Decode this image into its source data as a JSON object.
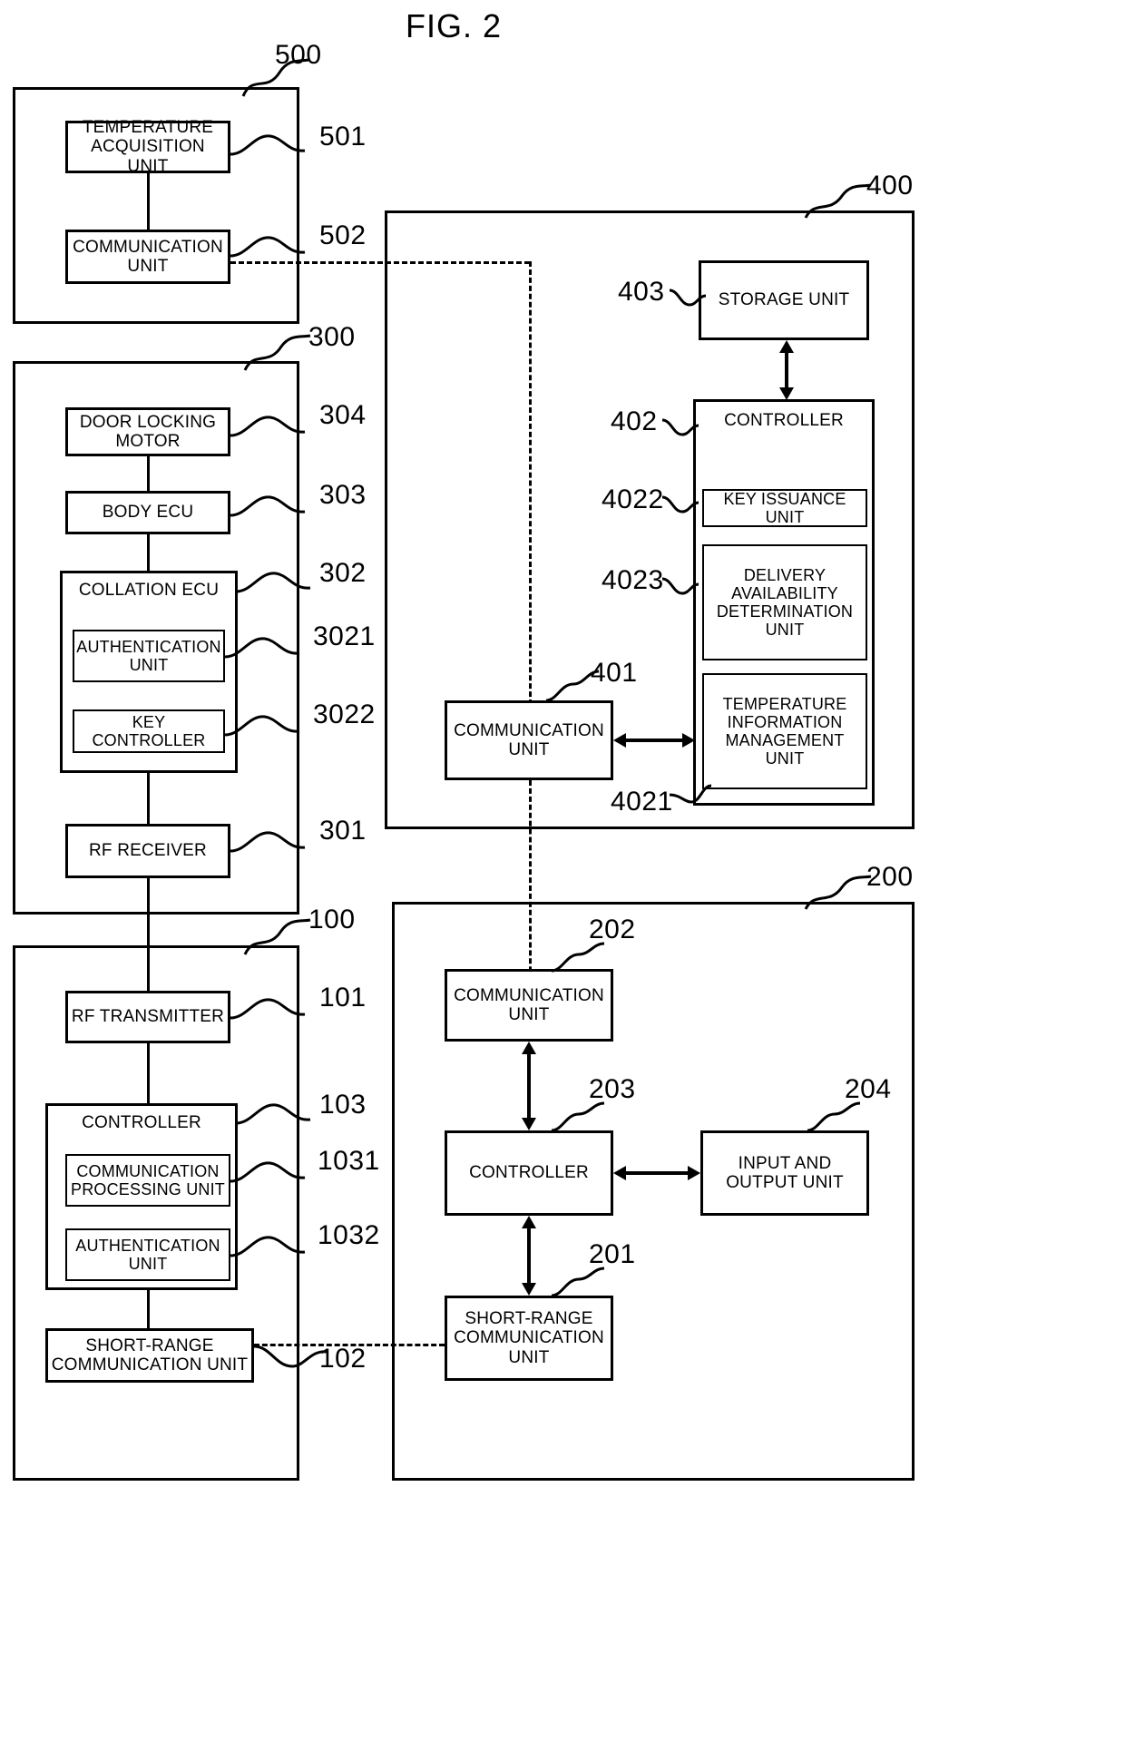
{
  "figure": {
    "title": "FIG. 2"
  },
  "groups": {
    "g500": {
      "ref": "500"
    },
    "g300": {
      "ref": "300"
    },
    "g100": {
      "ref": "100"
    },
    "g400": {
      "ref": "400"
    },
    "g200": {
      "ref": "200"
    }
  },
  "blocks": {
    "temperature_acquisition_unit": {
      "label": "TEMPERATURE ACQUISITION UNIT",
      "ref": "501"
    },
    "sensor_communication_unit": {
      "label": "COMMUNICATION UNIT",
      "ref": "502"
    },
    "door_locking_motor": {
      "label": "DOOR LOCKING MOTOR",
      "ref": "304"
    },
    "body_ecu": {
      "label": "BODY ECU",
      "ref": "303"
    },
    "collation_ecu": {
      "label": "COLLATION ECU",
      "ref": "302"
    },
    "authentication_unit_302": {
      "label": "AUTHENTICATION UNIT",
      "ref": "3021"
    },
    "key_controller": {
      "label": "KEY CONTROLLER",
      "ref": "3022"
    },
    "rf_receiver": {
      "label": "RF RECEIVER",
      "ref": "301"
    },
    "rf_transmitter": {
      "label": "RF TRANSMITTER",
      "ref": "101"
    },
    "controller_100": {
      "label": "CONTROLLER",
      "ref": "103"
    },
    "communication_processing_unit": {
      "label": "COMMUNICATION PROCESSING UNIT",
      "ref": "1031"
    },
    "authentication_unit_103": {
      "label": "AUTHENTICATION UNIT",
      "ref": "1032"
    },
    "short_range_communication_unit_100": {
      "label": "SHORT-RANGE COMMUNICATION UNIT",
      "ref": "102"
    },
    "storage_unit": {
      "label": "STORAGE UNIT",
      "ref": "403"
    },
    "controller_400": {
      "label": "CONTROLLER",
      "ref": "402"
    },
    "key_issuance_unit": {
      "label": "KEY ISSUANCE UNIT",
      "ref": "4022"
    },
    "delivery_availability_determination_unit": {
      "label": "DELIVERY AVAILABILITY DETERMINATION UNIT",
      "ref": "4023"
    },
    "temperature_information_management_unit": {
      "label": "TEMPERATURE INFORMATION MANAGEMENT UNIT",
      "ref": "4021"
    },
    "communication_unit_400": {
      "label": "COMMUNICATION UNIT",
      "ref": "401"
    },
    "communication_unit_200": {
      "label": "COMMUNICATION UNIT",
      "ref": "202"
    },
    "controller_200": {
      "label": "CONTROLLER",
      "ref": "203"
    },
    "input_and_output_unit": {
      "label": "INPUT AND OUTPUT UNIT",
      "ref": "204"
    },
    "short_range_communication_unit_200": {
      "label": "SHORT-RANGE COMMUNICATION UNIT",
      "ref": "201"
    }
  },
  "chart_data": {
    "type": "diagram",
    "title": "FIG. 2",
    "nodes": [
      {
        "id": "500",
        "label": "",
        "kind": "group"
      },
      {
        "id": "501",
        "label": "TEMPERATURE ACQUISITION UNIT",
        "parent": "500"
      },
      {
        "id": "502",
        "label": "COMMUNICATION UNIT",
        "parent": "500"
      },
      {
        "id": "300",
        "label": "",
        "kind": "group"
      },
      {
        "id": "304",
        "label": "DOOR LOCKING MOTOR",
        "parent": "300"
      },
      {
        "id": "303",
        "label": "BODY ECU",
        "parent": "300"
      },
      {
        "id": "302",
        "label": "COLLATION ECU",
        "parent": "300"
      },
      {
        "id": "3021",
        "label": "AUTHENTICATION UNIT",
        "parent": "302"
      },
      {
        "id": "3022",
        "label": "KEY CONTROLLER",
        "parent": "302"
      },
      {
        "id": "301",
        "label": "RF RECEIVER",
        "parent": "300"
      },
      {
        "id": "100",
        "label": "",
        "kind": "group"
      },
      {
        "id": "101",
        "label": "RF TRANSMITTER",
        "parent": "100"
      },
      {
        "id": "103",
        "label": "CONTROLLER",
        "parent": "100"
      },
      {
        "id": "1031",
        "label": "COMMUNICATION PROCESSING UNIT",
        "parent": "103"
      },
      {
        "id": "1032",
        "label": "AUTHENTICATION UNIT",
        "parent": "103"
      },
      {
        "id": "102",
        "label": "SHORT-RANGE COMMUNICATION UNIT",
        "parent": "100"
      },
      {
        "id": "400",
        "label": "",
        "kind": "group"
      },
      {
        "id": "403",
        "label": "STORAGE UNIT",
        "parent": "400"
      },
      {
        "id": "402",
        "label": "CONTROLLER",
        "parent": "400"
      },
      {
        "id": "4022",
        "label": "KEY ISSUANCE UNIT",
        "parent": "402"
      },
      {
        "id": "4023",
        "label": "DELIVERY AVAILABILITY DETERMINATION UNIT",
        "parent": "402"
      },
      {
        "id": "4021",
        "label": "TEMPERATURE INFORMATION MANAGEMENT UNIT",
        "parent": "402"
      },
      {
        "id": "401",
        "label": "COMMUNICATION UNIT",
        "parent": "400"
      },
      {
        "id": "200",
        "label": "",
        "kind": "group"
      },
      {
        "id": "202",
        "label": "COMMUNICATION UNIT",
        "parent": "200"
      },
      {
        "id": "203",
        "label": "CONTROLLER",
        "parent": "200"
      },
      {
        "id": "204",
        "label": "INPUT AND OUTPUT UNIT",
        "parent": "200"
      },
      {
        "id": "201",
        "label": "SHORT-RANGE COMMUNICATION UNIT",
        "parent": "200"
      }
    ],
    "edges": [
      {
        "from": "501",
        "to": "502",
        "style": "solid"
      },
      {
        "from": "304",
        "to": "303",
        "style": "solid"
      },
      {
        "from": "303",
        "to": "302",
        "style": "solid"
      },
      {
        "from": "302",
        "to": "301",
        "style": "solid"
      },
      {
        "from": "301",
        "to": "101",
        "style": "solid"
      },
      {
        "from": "101",
        "to": "103",
        "style": "solid"
      },
      {
        "from": "103",
        "to": "102",
        "style": "solid"
      },
      {
        "from": "502",
        "to": "401",
        "style": "dashed"
      },
      {
        "from": "102",
        "to": "201",
        "style": "dashed"
      },
      {
        "from": "401",
        "to": "202",
        "style": "dashed"
      },
      {
        "from": "403",
        "to": "402",
        "style": "double-arrow"
      },
      {
        "from": "401",
        "to": "402",
        "style": "double-arrow"
      },
      {
        "from": "202",
        "to": "203",
        "style": "double-arrow"
      },
      {
        "from": "203",
        "to": "201",
        "style": "double-arrow"
      },
      {
        "from": "203",
        "to": "204",
        "style": "double-arrow"
      }
    ]
  }
}
